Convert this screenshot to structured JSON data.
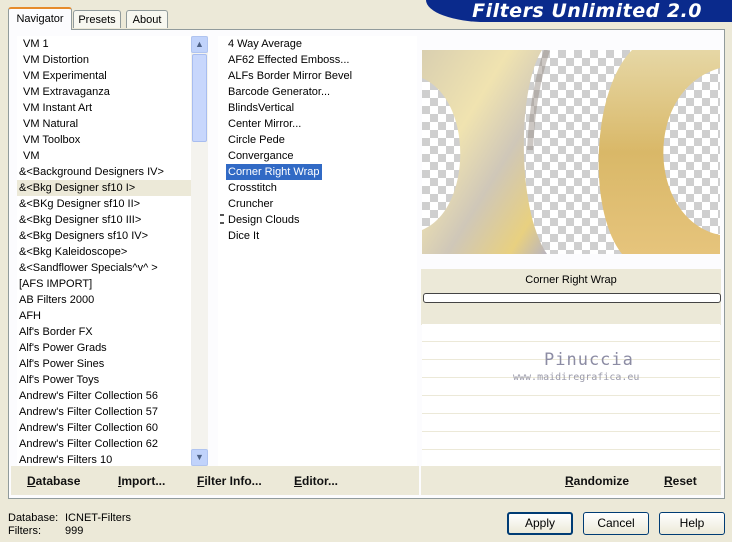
{
  "tabs": [
    {
      "label": "Navigator"
    },
    {
      "label": "Presets"
    },
    {
      "label": "About"
    }
  ],
  "brand": "Filters Unlimited 2.0",
  "categories": [
    "VM 1",
    "VM Distortion",
    "VM Experimental",
    "VM Extravaganza",
    "VM Instant Art",
    "VM Natural",
    "VM Toolbox",
    "VM",
    "&<Background Designers IV>",
    "&<Bkg Designer sf10 I>",
    "&<BKg Designer sf10 II>",
    "&<Bkg Designer sf10 III>",
    "&<Bkg Designers sf10 IV>",
    "&<Bkg Kaleidoscope>",
    "&<Sandflower Specials^v^ >",
    "[AFS IMPORT]",
    "AB Filters 2000",
    "AFH",
    "Alf's Border FX",
    "Alf's Power Grads",
    "Alf's Power Sines",
    "Alf's Power Toys",
    "Andrew's Filter Collection 56",
    "Andrew's Filter Collection 57",
    "Andrew's Filter Collection 60",
    "Andrew's Filter Collection 62",
    "Andrew's Filters 10"
  ],
  "filters": [
    "4 Way Average",
    "AF62 Effected Emboss...",
    "ALFs Border Mirror Bevel",
    "Barcode Generator...",
    "BlindsVertical",
    "Center Mirror...",
    "Circle Pede",
    "Convergance",
    "Corner Right Wrap",
    "Crosstitch",
    "Cruncher",
    "Design Clouds",
    "Dice It"
  ],
  "selected_filter_label": "Corner Right Wrap",
  "watermark": {
    "name": "Pinuccia",
    "url": "www.maidiregrafica.eu"
  },
  "bottom_left": {
    "database": "Database",
    "import": "Import...",
    "filter_info": "Filter Info...",
    "editor": "Editor..."
  },
  "bottom_right": {
    "randomize": "Randomize",
    "reset": "Reset"
  },
  "status": {
    "database_label": "Database:",
    "database_value": "ICNET-Filters",
    "filters_label": "Filters:",
    "filters_value": "999"
  },
  "dialog_buttons": {
    "apply": "Apply",
    "cancel": "Cancel",
    "help": "Help"
  },
  "colors": {
    "brand_bg": "#0a2a8c",
    "selection": "#316ac5",
    "tab_accent": "#e68b2c"
  }
}
